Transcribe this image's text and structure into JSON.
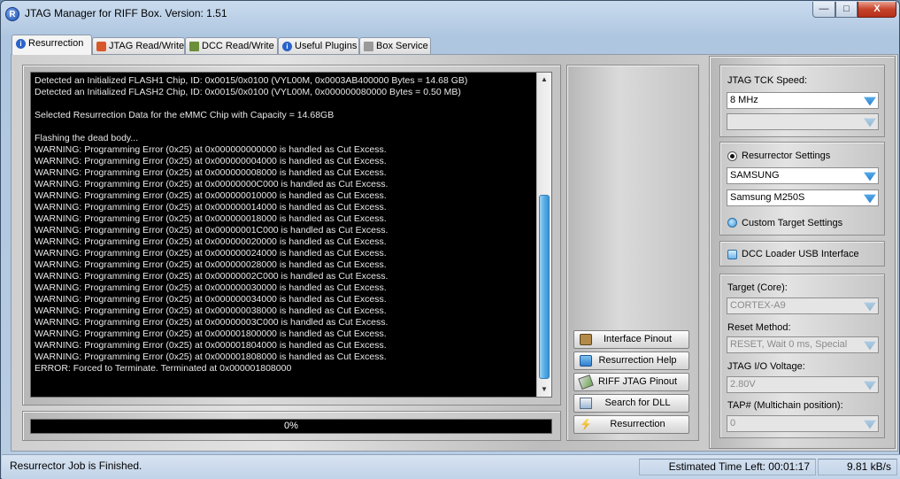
{
  "window": {
    "title": "JTAG Manager for RIFF Box. Version: 1.51",
    "app_icon_letter": "R",
    "minimize": "—",
    "maximize": "□",
    "close": "X"
  },
  "tabs": [
    {
      "label": "Resurrection",
      "icon": "info-icon",
      "color": "#2a63c9"
    },
    {
      "label": "JTAG Read/Write",
      "icon": "chip-icon",
      "color": "#d9582b"
    },
    {
      "label": "DCC Read/Write",
      "icon": "books-icon",
      "color": "#6c8f3c"
    },
    {
      "label": "Useful Plugins",
      "icon": "info-icon",
      "color": "#2a63c9"
    },
    {
      "label": "Box Service",
      "icon": "printer-icon",
      "color": "#8a8a8a"
    }
  ],
  "log": {
    "lines": [
      "Detected an Initialized FLASH1 Chip, ID: 0x0015/0x0100 (VYL00M, 0x0003AB400000 Bytes = 14.68 GB)",
      "Detected an Initialized FLASH2 Chip, ID: 0x0015/0x0100 (VYL00M, 0x000000080000 Bytes = 0.50 MB)",
      "",
      "Selected Resurrection Data for the eMMC Chip with Capacity = 14.68GB",
      "",
      "Flashing the dead body...",
      "WARNING: Programming Error (0x25) at 0x000000000000 is handled as Cut Excess.",
      "WARNING: Programming Error (0x25) at 0x000000004000 is handled as Cut Excess.",
      "WARNING: Programming Error (0x25) at 0x000000008000 is handled as Cut Excess.",
      "WARNING: Programming Error (0x25) at 0x00000000C000 is handled as Cut Excess.",
      "WARNING: Programming Error (0x25) at 0x000000010000 is handled as Cut Excess.",
      "WARNING: Programming Error (0x25) at 0x000000014000 is handled as Cut Excess.",
      "WARNING: Programming Error (0x25) at 0x000000018000 is handled as Cut Excess.",
      "WARNING: Programming Error (0x25) at 0x00000001C000 is handled as Cut Excess.",
      "WARNING: Programming Error (0x25) at 0x000000020000 is handled as Cut Excess.",
      "WARNING: Programming Error (0x25) at 0x000000024000 is handled as Cut Excess.",
      "WARNING: Programming Error (0x25) at 0x000000028000 is handled as Cut Excess.",
      "WARNING: Programming Error (0x25) at 0x00000002C000 is handled as Cut Excess.",
      "WARNING: Programming Error (0x25) at 0x000000030000 is handled as Cut Excess.",
      "WARNING: Programming Error (0x25) at 0x000000034000 is handled as Cut Excess.",
      "WARNING: Programming Error (0x25) at 0x000000038000 is handled as Cut Excess.",
      "WARNING: Programming Error (0x25) at 0x00000003C000 is handled as Cut Excess.",
      "WARNING: Programming Error (0x25) at 0x000001800000 is handled as Cut Excess.",
      "WARNING: Programming Error (0x25) at 0x000001804000 is handled as Cut Excess.",
      "WARNING: Programming Error (0x25) at 0x000001808000 is handled as Cut Excess.",
      "ERROR: Forced to Terminate. Terminated at 0x000001808000"
    ],
    "scroll_up": "▲",
    "scroll_down": "▼"
  },
  "progress": {
    "text": "0%",
    "value": 0
  },
  "actions": [
    {
      "label": "Interface Pinout",
      "icon": "chip-icon",
      "name": "interface-pinout-button"
    },
    {
      "label": "Resurrection Help",
      "icon": "help-book-icon",
      "name": "resurrection-help-button"
    },
    {
      "label": "RIFF JTAG Pinout",
      "icon": "cable-icon",
      "name": "riff-jtag-pinout-button"
    },
    {
      "label": "Search for DLL",
      "icon": "search-dll-icon",
      "name": "search-dll-button"
    },
    {
      "label": "Resurrection",
      "icon": "lightning-icon",
      "name": "resurrection-button"
    }
  ],
  "settings": {
    "tck_label": "JTAG TCK Speed:",
    "tck_value": "8 MHz",
    "tck_second_value": "",
    "resurrector_label": "Resurrector Settings",
    "manufacturer": "SAMSUNG",
    "model": "Samsung M250S",
    "custom_label": "Custom Target Settings",
    "dcc_label": "DCC Loader USB Interface",
    "target_label": "Target (Core):",
    "target_value": "CORTEX-A9",
    "reset_label": "Reset Method:",
    "reset_value": "RESET, Wait 0 ms, Special",
    "voltage_label": "JTAG I/O Voltage:",
    "voltage_value": "2.80V",
    "tap_label": "TAP# (Multichain position):",
    "tap_value": "0"
  },
  "status": {
    "message": "Resurrector Job is Finished.",
    "time_left": "Estimated Time Left: 00:01:17",
    "speed": "9.81 kB/s"
  },
  "colors": {
    "accent_blue": "#3a92d4",
    "log_background": "#000000",
    "close_red": "#c7422a"
  }
}
